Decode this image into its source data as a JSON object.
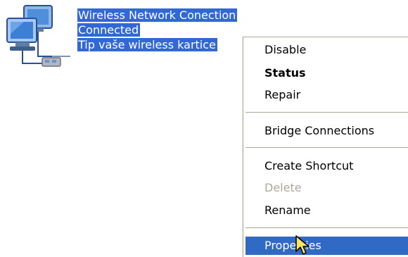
{
  "connection": {
    "name": "Wireless Network Conection",
    "status": "Connected",
    "device": "Tip vaše wireless kartice"
  },
  "context_menu": {
    "items": [
      {
        "label": "Disable",
        "state": "normal"
      },
      {
        "label": "Status",
        "state": "default"
      },
      {
        "label": "Repair",
        "state": "normal"
      },
      {
        "label": "Bridge Connections",
        "state": "normal"
      },
      {
        "label": "Create Shortcut",
        "state": "normal"
      },
      {
        "label": "Delete",
        "state": "disabled"
      },
      {
        "label": "Rename",
        "state": "normal"
      },
      {
        "label": "Properties",
        "state": "highlighted"
      }
    ]
  },
  "colors": {
    "selection": "#316ac5",
    "disabled_text": "#aca899",
    "menu_border": "#aca899"
  },
  "icons": {
    "connection": "network-connection-icon",
    "pointer": "mouse-pointer-icon"
  }
}
